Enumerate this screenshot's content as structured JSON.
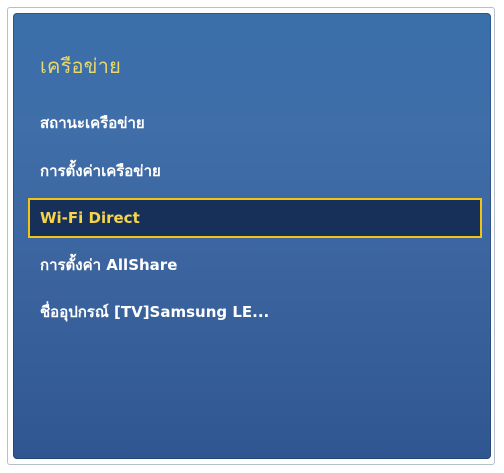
{
  "panel": {
    "title": "เครือข่าย",
    "title_color": "#e9d86a",
    "background_color": "#3b68a3",
    "selected_border_color": "#f2c313",
    "selected_background_color": "#16305a"
  },
  "menu": {
    "items": [
      {
        "label": "สถานะเครือข่าย",
        "selected": false
      },
      {
        "label": "การตั้งค่าเครือข่าย",
        "selected": false
      },
      {
        "label": "Wi-Fi Direct",
        "selected": true
      },
      {
        "label": "การตั้งค่า AllShare",
        "selected": false
      },
      {
        "label": "ชื่ออุปกรณ์  [TV]Samsung LE...",
        "selected": false
      }
    ]
  }
}
